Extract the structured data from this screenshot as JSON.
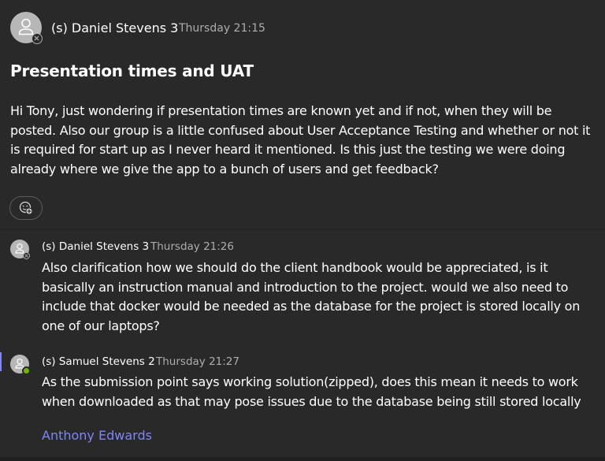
{
  "post": {
    "author": "(s) Daniel Stevens 3",
    "timestamp": "Thursday 21:15",
    "subject": "Presentation times and UAT",
    "body_lines": [
      "Hi Tony, just wondering if presentation times are known yet and if not, when they will be",
      "posted. Also our group is a little confused about User Acceptance Testing and whether or not it",
      "is required for start up as I never heard it mentioned. Is this just the testing we were doing",
      "already where we give the app to a bunch of users and get feedback?"
    ],
    "author_status": "offline",
    "reaction_icon": "add-reaction-icon"
  },
  "replies": [
    {
      "author": "(s) Daniel Stevens 3",
      "timestamp": "Thursday 21:26",
      "status": "offline",
      "body_lines": [
        "Also clarification how we should do the client handbook would be appreciated, is it",
        "basically an instruction manual and introduction to the project. would we also need to",
        "include that docker would be needed as the database for the project is stored locally on",
        "one of our laptops?"
      ]
    },
    {
      "author": "(s) Samuel Stevens 2",
      "timestamp": "Thursday 21:27",
      "status": "online",
      "body_lines": [
        "As the submission point says working solution(zipped), does this mean it needs to work",
        "when downloaded as that may pose issues due to the database being still stored locally"
      ]
    }
  ],
  "reply_link": "Anthony Edwards",
  "colors": {
    "background": "#292929",
    "accent": "#7f85f5",
    "online": "#6bb700",
    "muted_text": "#adadad"
  }
}
